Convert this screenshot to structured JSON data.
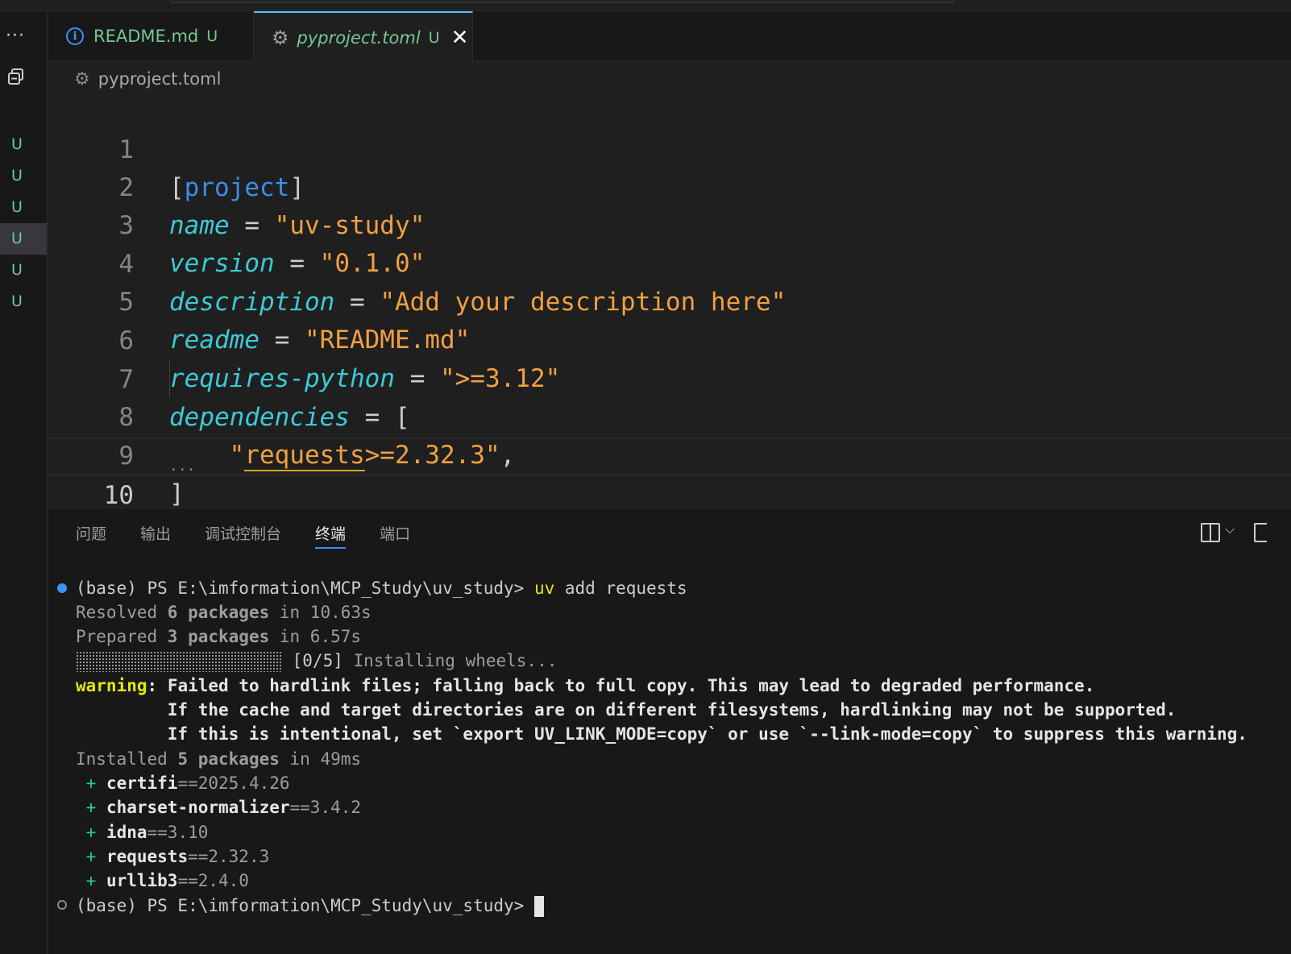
{
  "tabs": [
    {
      "name": "README.md",
      "status": "U"
    },
    {
      "name": "pyproject.toml",
      "status": "U",
      "close": "✕"
    }
  ],
  "breadcrumb": "pyproject.toml",
  "scm_badges": [
    "U",
    "U",
    "U",
    "U",
    "U",
    "U"
  ],
  "activity": {
    "more": "···"
  },
  "editor": {
    "line_numbers": [
      "1",
      "2",
      "3",
      "4",
      "5",
      "6",
      "7",
      "8",
      "9",
      "10"
    ],
    "l1": {
      "open": "[",
      "section": "project",
      "close": "]"
    },
    "l2": {
      "key": "name",
      "op": " = ",
      "val": "\"uv-study\""
    },
    "l3": {
      "key": "version",
      "op": " = ",
      "val": "\"0.1.0\""
    },
    "l4": {
      "key": "description",
      "op": " = ",
      "val": "\"Add your description here\""
    },
    "l5": {
      "key": "readme",
      "op": " = ",
      "val": "\"README.md\""
    },
    "l6": {
      "key": "requires-python",
      "op": " = ",
      "val": "\">=3.12\""
    },
    "l7": {
      "key": "dependencies",
      "op": " = ",
      "val": "["
    },
    "l8": {
      "q1": "    \"",
      "pkg": "requests",
      "rest": ">=2.32.3\"",
      "comma": ","
    },
    "l9": {
      "close": "]"
    },
    "ellipsis": "..."
  },
  "panel": {
    "tabs": [
      "问题",
      "输出",
      "调试控制台",
      "终端",
      "端口"
    ],
    "active_tab": "终端"
  },
  "terminal": {
    "prompt": "(base) PS E:\\imformation\\MCP_Study\\uv_study>",
    "cmd_uv": "uv",
    "cmd_rest": " add requests",
    "resolved": {
      "a": "Resolved ",
      "n": "6 packages",
      "b": " in 10.63s"
    },
    "prepared": {
      "a": "Prepared ",
      "n": "3 packages",
      "b": " in 6.57s"
    },
    "installing": " [0/5]",
    "installing_msg": " Installing wheels...",
    "warn_label": "warning",
    "warn_colon": ":",
    "warn1": " Failed to hardlink files; falling back to full copy. This may lead to degraded performance.",
    "warn2": "         If the cache and target directories are on different filesystems, hardlinking may not be supported.",
    "warn3": "         If this is intentional, set `export UV_LINK_MODE=copy` or use `--link-mode=copy` to suppress this warning.",
    "installed": {
      "a": "Installed ",
      "n": "5 packages",
      "b": " in 49ms"
    },
    "packages": [
      {
        "plus": " + ",
        "name": "certifi",
        "ver": "==2025.4.26"
      },
      {
        "plus": " + ",
        "name": "charset-normalizer",
        "ver": "==3.4.2"
      },
      {
        "plus": " + ",
        "name": "idna",
        "ver": "==3.10"
      },
      {
        "plus": " + ",
        "name": "requests",
        "ver": "==2.32.3"
      },
      {
        "plus": " + ",
        "name": "urllib3",
        "ver": "==2.4.0"
      }
    ]
  }
}
